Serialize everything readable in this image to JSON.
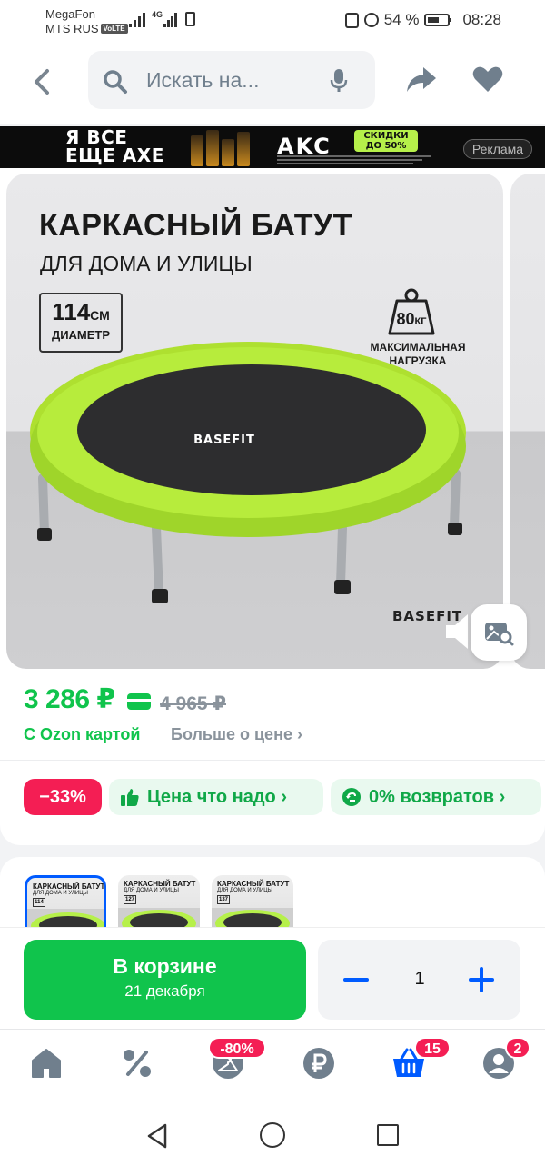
{
  "status_bar": {
    "carrier1": "MegaFon",
    "carrier2": "MTS RUS",
    "volte": "VoLTE",
    "network": "4G",
    "battery": "54 %",
    "time": "08:28"
  },
  "header": {
    "search_placeholder": "Искать на...",
    "icons": [
      "back-arrow-icon",
      "search-icon",
      "mic-icon",
      "share-icon",
      "heart-icon"
    ]
  },
  "ad_banner": {
    "headline_line1": "Я ВСЕ",
    "headline_line2": "ЕЩЕ AXE",
    "brand": "AKC",
    "sale_line1": "СКИДКИ",
    "sale_line2": "ДО 50%",
    "label": "Реклама"
  },
  "product_image": {
    "title": "КАРКАСНЫЙ БАТУТ",
    "subtitle": "ДЛЯ ДОМА И УЛИЦЫ",
    "diameter_value": "114",
    "diameter_unit": "СМ",
    "diameter_label": "ДИАМЕТР",
    "weight_value": "80",
    "weight_unit": "КГ",
    "weight_label_line1": "МАКСИМАЛЬНАЯ",
    "weight_label_line2": "НАГРУЗКА",
    "mat_logo": "BASEFIT",
    "brand_logo": "BASEFIT"
  },
  "price": {
    "current": "3 286 ₽",
    "old": "4 965 ₽",
    "ozon_card": "С Ozon картой",
    "more": "Больше о цене ›"
  },
  "badges": {
    "discount": "−33%",
    "good_price": "Цена что надо ›",
    "returns": "0% возвратов ›"
  },
  "thumbnails": [
    {
      "title": "КАРКАСНЫЙ БАТУТ",
      "sub": "ДЛЯ ДОМА И УЛИЦЫ",
      "diam": "114",
      "active": true
    },
    {
      "title": "КАРКАСНЫЙ БАТУТ",
      "sub": "ДЛЯ ДОМА И УЛИЦЫ",
      "diam": "127",
      "active": false
    },
    {
      "title": "КАРКАСНЫЙ БАТУТ",
      "sub": "ДЛЯ ДОМА И УЛИЦЫ",
      "diam": "137",
      "active": false
    }
  ],
  "cart": {
    "label": "В корзине",
    "date": "21 декабря",
    "quantity": "1"
  },
  "tabbar": {
    "sale_badge": "-80%",
    "cart_badge": "15",
    "profile_badge": "2"
  },
  "colors": {
    "accent_green": "#10c44c",
    "accent_blue": "#005bff",
    "badge_red": "#f41e54"
  }
}
